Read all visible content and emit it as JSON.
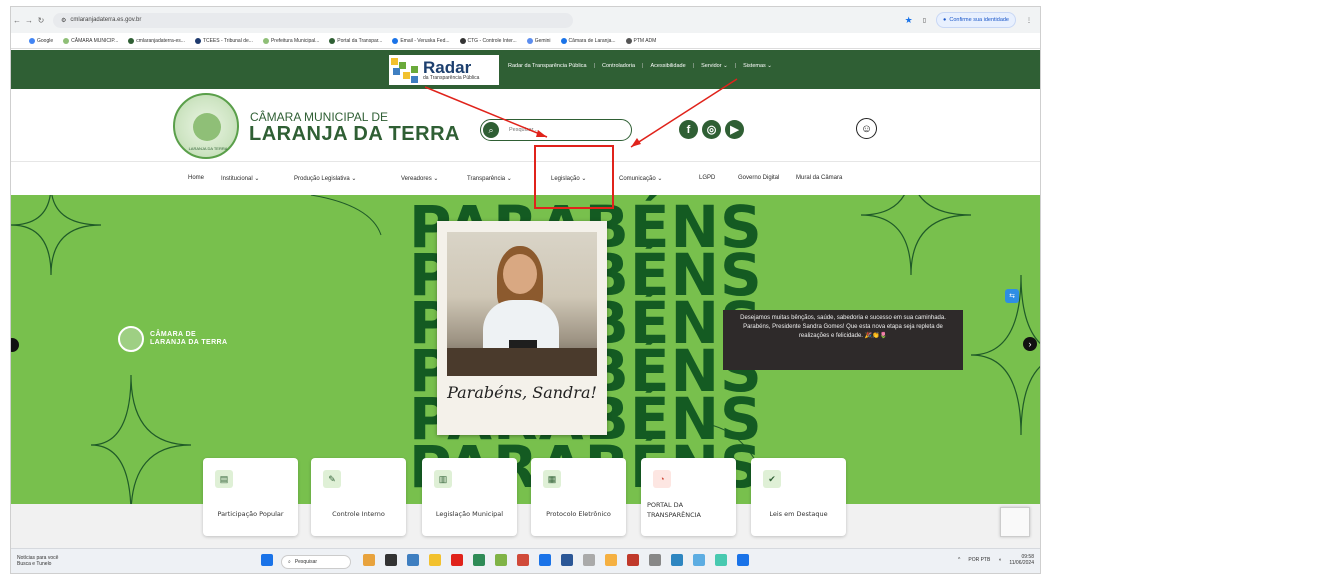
{
  "browser": {
    "url": "cmlaranjadaterra.es.gov.br",
    "confirm_identity": "Confirme sua identidade",
    "bookmarks": [
      "Google",
      "CÂMARA MUNICIP...",
      "cmlaranjadaterra-es...",
      "TCEES - Tribunal de...",
      "Prefeitura Municipal...",
      "Portal da Transpar...",
      "Email - Veruska Fed...",
      "CTG - Controle Inter...",
      "Gemini",
      "Câmara de Laranja...",
      "PTM ADM"
    ]
  },
  "topbar": {
    "radar_title": "Radar",
    "radar_subtitle": "da Transparência Pública",
    "links": [
      "Radar da Transparência Pública",
      "|",
      "Controladoria",
      "|",
      "Acessibilidade",
      "|",
      "Servidor ⌄",
      "|",
      "Sistemas ⌄"
    ]
  },
  "header": {
    "seal_text": "LARANJA DA TERRA",
    "name_small": "CÂMARA MUNICIPAL DE",
    "name_big": "LARANJA DA TERRA",
    "search_placeholder": "Pesquisar..."
  },
  "nav": {
    "items": [
      "Home",
      "Institucional ⌄",
      "Produção Legislativa ⌄",
      "Vereadores ⌄",
      "Transparência ⌄",
      "Legislação ⌄",
      "Comunicação ⌄",
      "LGPD",
      "Governo Digital",
      "Mural da Câmara"
    ]
  },
  "hero": {
    "word": "PARABÉNS",
    "caption": "Parabéns, Sandra!",
    "brand_line1": "CÂMARA DE",
    "brand_line2": "LARANJA DA TERRA",
    "message": "Desejamos muitas bênçãos, saúde, sabedoria e sucesso em sua caminhada. Parabéns, Presidente Sandra Gomes! Que esta nova etapa seja repleta de realizações e felicidade. 🎉👏🌷"
  },
  "quick_links": [
    "Participação Popular",
    "Controle Interno",
    "Legislação Municipal",
    "Protocolo Eletrônico",
    "PORTAL DA TRANSPARÊNCIA",
    "Leis em Destaque"
  ],
  "taskbar": {
    "news_title": "Notícias para você",
    "news_sub": "Busca e Tunelo",
    "search": "Pesquisar",
    "lang": "POR PTB",
    "time": "09:58",
    "date": "11/06/2024"
  },
  "colors": {
    "site_green": "#2f5f34",
    "hero_green": "#78c04d",
    "highlight_red": "#e0231b"
  }
}
